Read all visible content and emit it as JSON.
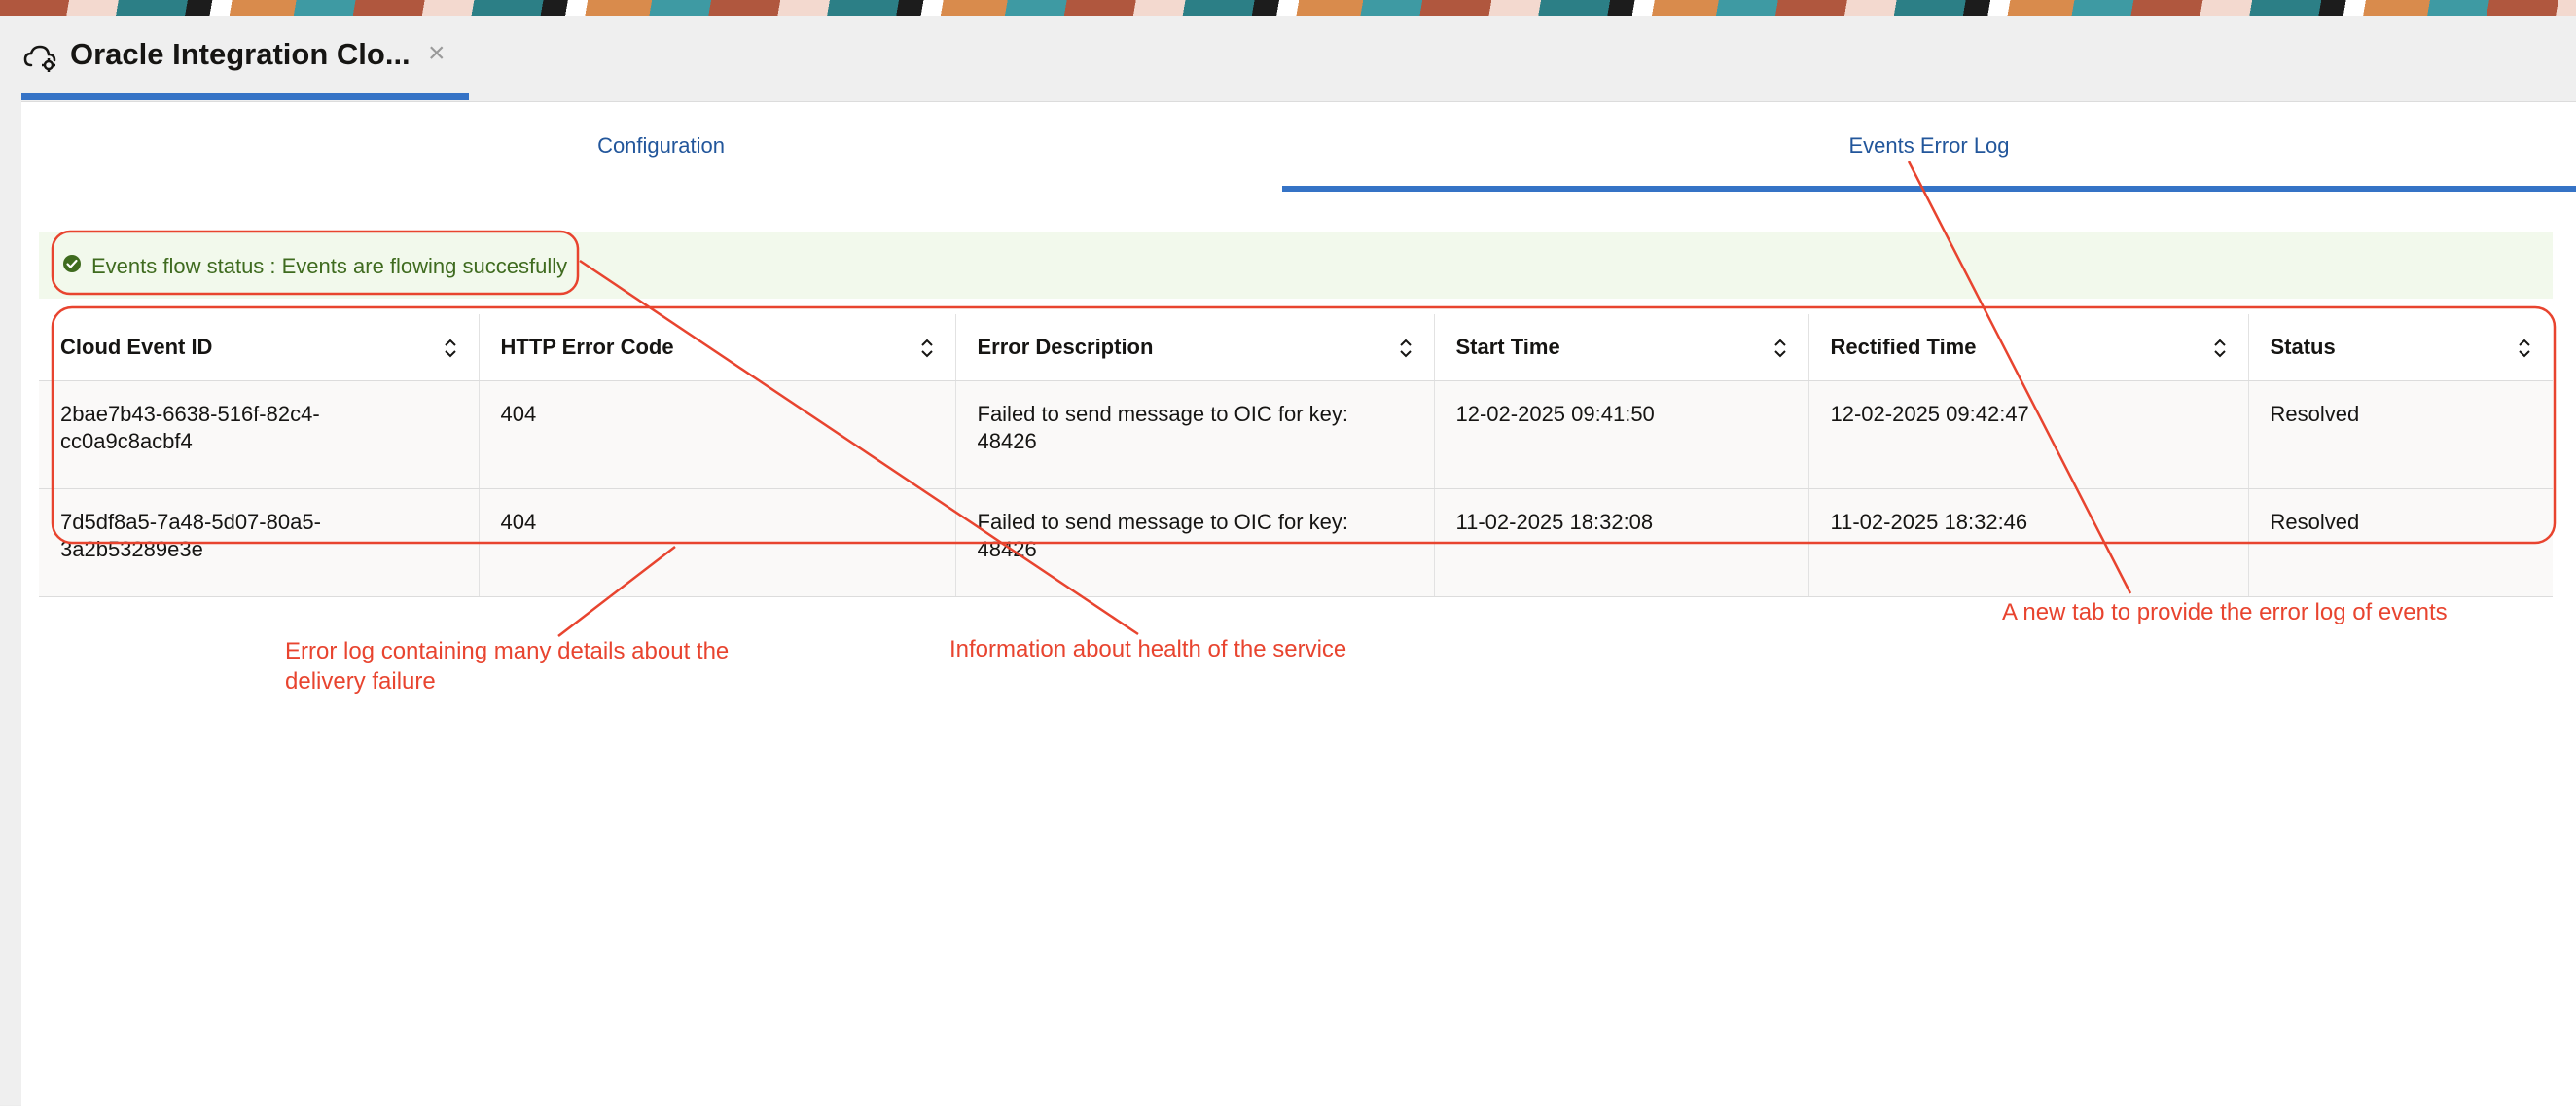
{
  "app_tab": {
    "title": "Oracle Integration Clo...",
    "close_label": "×",
    "icon": "cloud-gear-icon"
  },
  "subtabs": [
    {
      "label": "Configuration",
      "selected": false
    },
    {
      "label": "Events Error Log",
      "selected": true
    }
  ],
  "status": {
    "text": "Events flow status : Events are flowing succesfully",
    "icon": "check-circle-icon",
    "color": "#3f6b1f"
  },
  "table": {
    "columns": [
      "Cloud Event ID",
      "HTTP Error Code",
      "Error Description",
      "Start Time",
      "Rectified Time",
      "Status"
    ],
    "rows": [
      {
        "event_id_line1": "2bae7b43-6638-516f-82c4-",
        "event_id_line2": "cc0a9c8acbf4",
        "code": "404",
        "description": "Failed to send message to OIC for key: 48426",
        "start": "12-02-2025 09:41:50",
        "rectified": "12-02-2025 09:42:47",
        "status": "Resolved"
      },
      {
        "event_id_line1": "7d5df8a5-7a48-5d07-80a5-",
        "event_id_line2": "3a2b53289e3e",
        "code": "404",
        "description": "Failed to send message to OIC for key: 48426",
        "start": "11-02-2025 18:32:08",
        "rectified": "11-02-2025 18:32:46",
        "status": "Resolved"
      }
    ]
  },
  "annotations": {
    "error_log_line1": "Error log containing many details about the",
    "error_log_line2": "delivery failure",
    "health": "Information about health of the service",
    "new_tab": "A new tab to provide the error log of events",
    "color": "#e8442f"
  },
  "colors": {
    "accent": "#3573c6",
    "link": "#22569b",
    "banner_bg": "#f2f9ec"
  }
}
